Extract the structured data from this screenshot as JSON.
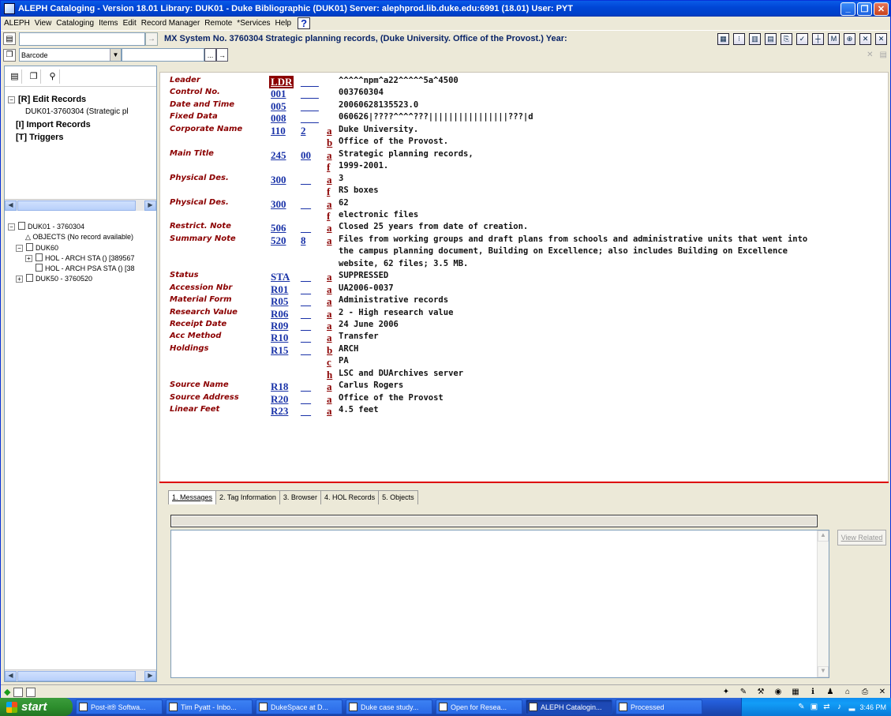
{
  "window": {
    "title": "ALEPH Cataloging - Version 18.01  Library:  DUK01 - Duke Bibliographic (DUK01)  Server:  alephprod.lib.duke.edu:6991 (18.01)  User:  PYT"
  },
  "menu": [
    "ALEPH",
    "View",
    "Cataloging",
    "Items",
    "Edit",
    "Record Manager",
    "Remote",
    "*Services",
    "Help"
  ],
  "toolbar": {
    "record_title": "MX System No. 3760304 Strategic planning records, (Duke University. Office of the Provost.) Year:",
    "search_type": "Barcode",
    "browse_btn": "...",
    "go_arrow": "→"
  },
  "left_tree": {
    "top_nodes": [
      {
        "label": "[R] Edit Records"
      },
      {
        "label": "DUK01-3760304 (Strategic pl"
      },
      {
        "label": "[I] Import Records"
      },
      {
        "label": "[T] Triggers"
      }
    ],
    "bottom_nodes": [
      {
        "label": "DUK01 - 3760304"
      },
      {
        "label": "OBJECTS (No record available)"
      },
      {
        "label": "DUK60"
      },
      {
        "label": "HOL - ARCH STA () [389567"
      },
      {
        "label": "HOL - ARCH PSA STA () [38"
      },
      {
        "label": "DUK50 - 3760520"
      }
    ]
  },
  "record": {
    "fields": [
      {
        "name": "Leader",
        "tag": "LDR",
        "ind": "__ _",
        "sub": "",
        "value": "^^^^^npm^a22^^^^^5a^4500"
      },
      {
        "name": "Control No.",
        "tag": "001",
        "ind": "__ _",
        "sub": "",
        "value": "003760304"
      },
      {
        "name": "Date and Time",
        "tag": "005",
        "ind": "__ _",
        "sub": "",
        "value": "20060628135523.0"
      },
      {
        "name": "Fixed Data",
        "tag": "008",
        "ind": "__ _",
        "sub": "",
        "value": "060626|????^^^^???||||||||||||||||???|d"
      },
      {
        "name": "Corporate Name",
        "tag": "110",
        "ind": "2",
        "sub": "a",
        "value": "Duke University."
      },
      {
        "name": "",
        "tag": "",
        "ind": "",
        "sub": "b",
        "value": "Office of the Provost."
      },
      {
        "name": "Main Title",
        "tag": "245",
        "ind": "00",
        "sub": "a",
        "value": "Strategic planning records,"
      },
      {
        "name": "",
        "tag": "",
        "ind": "",
        "sub": "f",
        "value": "1999-2001."
      },
      {
        "name": "Physical Des.",
        "tag": "300",
        "ind": "__",
        "sub": "a",
        "value": "3"
      },
      {
        "name": "",
        "tag": "",
        "ind": "",
        "sub": "f",
        "value": "RS boxes"
      },
      {
        "name": "Physical Des.",
        "tag": "300",
        "ind": "__",
        "sub": "a",
        "value": "62"
      },
      {
        "name": "",
        "tag": "",
        "ind": "",
        "sub": "f",
        "value": "electronic files"
      },
      {
        "name": "Restrict. Note",
        "tag": "506",
        "ind": "__",
        "sub": "a",
        "value": "Closed 25 years from date of creation."
      },
      {
        "name": "Summary Note",
        "tag": "520",
        "ind": "8",
        "sub": "a",
        "value": "Files from working groups and draft plans from schools and administrative units that went into"
      },
      {
        "name": "",
        "tag": "",
        "ind": "",
        "sub": "",
        "value": "the campus planning document, Building on Excellence; also includes Building on Excellence"
      },
      {
        "name": "",
        "tag": "",
        "ind": "",
        "sub": "",
        "value": "website, 62 files; 3.5 MB."
      },
      {
        "name": "Status",
        "tag": "STA",
        "ind": "__",
        "sub": "a",
        "value": "SUPPRESSED"
      },
      {
        "name": "Accession Nbr",
        "tag": "R01",
        "ind": "__",
        "sub": "a",
        "value": "UA2006-0037"
      },
      {
        "name": "Material Form",
        "tag": "R05",
        "ind": "__",
        "sub": "a",
        "value": "Administrative records"
      },
      {
        "name": "Research Value",
        "tag": "R06",
        "ind": "__",
        "sub": "a",
        "value": "2 - High research value"
      },
      {
        "name": "Receipt Date",
        "tag": "R09",
        "ind": "__",
        "sub": "a",
        "value": "24 June 2006"
      },
      {
        "name": "Acc Method",
        "tag": "R10",
        "ind": "__",
        "sub": "a",
        "value": "Transfer"
      },
      {
        "name": "Holdings",
        "tag": "R15",
        "ind": "__",
        "sub": "b",
        "value": "ARCH"
      },
      {
        "name": "",
        "tag": "",
        "ind": "",
        "sub": "c",
        "value": "PA"
      },
      {
        "name": "",
        "tag": "",
        "ind": "",
        "sub": "h",
        "value": "LSC and DUArchives server"
      },
      {
        "name": "Source Name",
        "tag": "R18",
        "ind": "__",
        "sub": "a",
        "value": "Carlus Rogers"
      },
      {
        "name": "Source Address",
        "tag": "R20",
        "ind": "__",
        "sub": "a",
        "value": "Office of the Provost"
      },
      {
        "name": "Linear Feet",
        "tag": "R23",
        "ind": "__",
        "sub": "a",
        "value": "4.5 feet"
      }
    ]
  },
  "bottom_tabs": [
    "1. Messages",
    "2. Tag Information",
    "3. Browser",
    "4. HOL Records",
    "5. Objects"
  ],
  "view_related": "View Related",
  "taskbar": {
    "start": "start",
    "tasks": [
      "Post-it® Softwa...",
      "Tim Pyatt - Inbo...",
      "DukeSpace at D...",
      "Duke case study...",
      "Open for Resea...",
      "ALEPH Catalogin...",
      "Processed"
    ],
    "clock": "3:46 PM"
  }
}
